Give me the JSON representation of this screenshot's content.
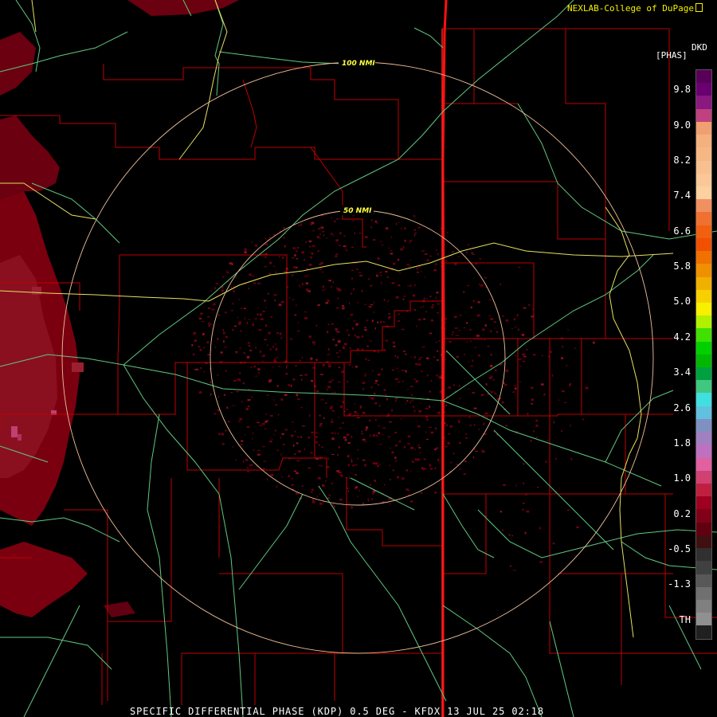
{
  "credit": "NEXLAB-College of DuPage",
  "product_code": "DKD",
  "units": "[PHAS]",
  "footer": "SPECIFIC DIFFERENTIAL PHASE (KDP) 0.5 DEG - KFDX 13 JUL 25 02:18",
  "range_rings": [
    {
      "label": "100 NMI"
    },
    {
      "label": "50 NMI"
    }
  ],
  "legend": {
    "ticks": [
      "9.8",
      "9.0",
      "8.2",
      "7.4",
      "6.6",
      "5.8",
      "5.0",
      "4.2",
      "3.4",
      "2.6",
      "1.8",
      "1.0",
      "0.2",
      "-0.5",
      "-1.3",
      "TH"
    ],
    "colors": [
      "#580058",
      "#6a0070",
      "#8a1880",
      "#c04080",
      "#f0a070",
      "#f5b080",
      "#f5b884",
      "#f8c090",
      "#fac898",
      "#fcd0a0",
      "#f09060",
      "#f07030",
      "#f06010",
      "#f05000",
      "#f07000",
      "#f09000",
      "#f0b000",
      "#f8d000",
      "#f8f000",
      "#b0f000",
      "#40e000",
      "#00d000",
      "#00b800",
      "#00a040",
      "#40c880",
      "#40e0e0",
      "#60c0e0",
      "#8090c0",
      "#a080c0",
      "#c070c0",
      "#e060a0",
      "#d04070",
      "#c02040",
      "#a00020",
      "#800018",
      "#600010",
      "#401010",
      "#303030",
      "#404040",
      "#585858",
      "#707070",
      "#808080",
      "#909090",
      "#202020"
    ]
  }
}
